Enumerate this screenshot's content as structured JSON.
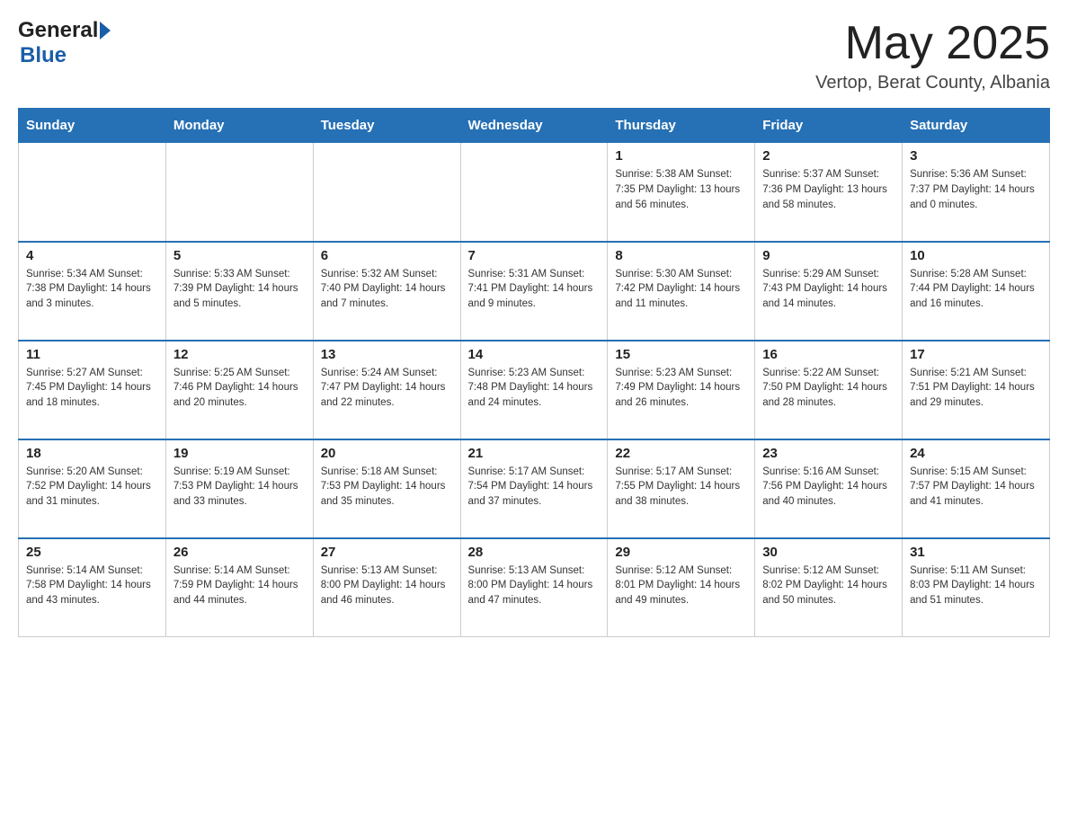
{
  "header": {
    "logo": {
      "general": "General",
      "blue": "Blue"
    },
    "month_year": "May 2025",
    "location": "Vertop, Berat County, Albania"
  },
  "weekdays": [
    "Sunday",
    "Monday",
    "Tuesday",
    "Wednesday",
    "Thursday",
    "Friday",
    "Saturday"
  ],
  "weeks": [
    [
      {
        "day": "",
        "info": ""
      },
      {
        "day": "",
        "info": ""
      },
      {
        "day": "",
        "info": ""
      },
      {
        "day": "",
        "info": ""
      },
      {
        "day": "1",
        "info": "Sunrise: 5:38 AM\nSunset: 7:35 PM\nDaylight: 13 hours\nand 56 minutes."
      },
      {
        "day": "2",
        "info": "Sunrise: 5:37 AM\nSunset: 7:36 PM\nDaylight: 13 hours\nand 58 minutes."
      },
      {
        "day": "3",
        "info": "Sunrise: 5:36 AM\nSunset: 7:37 PM\nDaylight: 14 hours\nand 0 minutes."
      }
    ],
    [
      {
        "day": "4",
        "info": "Sunrise: 5:34 AM\nSunset: 7:38 PM\nDaylight: 14 hours\nand 3 minutes."
      },
      {
        "day": "5",
        "info": "Sunrise: 5:33 AM\nSunset: 7:39 PM\nDaylight: 14 hours\nand 5 minutes."
      },
      {
        "day": "6",
        "info": "Sunrise: 5:32 AM\nSunset: 7:40 PM\nDaylight: 14 hours\nand 7 minutes."
      },
      {
        "day": "7",
        "info": "Sunrise: 5:31 AM\nSunset: 7:41 PM\nDaylight: 14 hours\nand 9 minutes."
      },
      {
        "day": "8",
        "info": "Sunrise: 5:30 AM\nSunset: 7:42 PM\nDaylight: 14 hours\nand 11 minutes."
      },
      {
        "day": "9",
        "info": "Sunrise: 5:29 AM\nSunset: 7:43 PM\nDaylight: 14 hours\nand 14 minutes."
      },
      {
        "day": "10",
        "info": "Sunrise: 5:28 AM\nSunset: 7:44 PM\nDaylight: 14 hours\nand 16 minutes."
      }
    ],
    [
      {
        "day": "11",
        "info": "Sunrise: 5:27 AM\nSunset: 7:45 PM\nDaylight: 14 hours\nand 18 minutes."
      },
      {
        "day": "12",
        "info": "Sunrise: 5:25 AM\nSunset: 7:46 PM\nDaylight: 14 hours\nand 20 minutes."
      },
      {
        "day": "13",
        "info": "Sunrise: 5:24 AM\nSunset: 7:47 PM\nDaylight: 14 hours\nand 22 minutes."
      },
      {
        "day": "14",
        "info": "Sunrise: 5:23 AM\nSunset: 7:48 PM\nDaylight: 14 hours\nand 24 minutes."
      },
      {
        "day": "15",
        "info": "Sunrise: 5:23 AM\nSunset: 7:49 PM\nDaylight: 14 hours\nand 26 minutes."
      },
      {
        "day": "16",
        "info": "Sunrise: 5:22 AM\nSunset: 7:50 PM\nDaylight: 14 hours\nand 28 minutes."
      },
      {
        "day": "17",
        "info": "Sunrise: 5:21 AM\nSunset: 7:51 PM\nDaylight: 14 hours\nand 29 minutes."
      }
    ],
    [
      {
        "day": "18",
        "info": "Sunrise: 5:20 AM\nSunset: 7:52 PM\nDaylight: 14 hours\nand 31 minutes."
      },
      {
        "day": "19",
        "info": "Sunrise: 5:19 AM\nSunset: 7:53 PM\nDaylight: 14 hours\nand 33 minutes."
      },
      {
        "day": "20",
        "info": "Sunrise: 5:18 AM\nSunset: 7:53 PM\nDaylight: 14 hours\nand 35 minutes."
      },
      {
        "day": "21",
        "info": "Sunrise: 5:17 AM\nSunset: 7:54 PM\nDaylight: 14 hours\nand 37 minutes."
      },
      {
        "day": "22",
        "info": "Sunrise: 5:17 AM\nSunset: 7:55 PM\nDaylight: 14 hours\nand 38 minutes."
      },
      {
        "day": "23",
        "info": "Sunrise: 5:16 AM\nSunset: 7:56 PM\nDaylight: 14 hours\nand 40 minutes."
      },
      {
        "day": "24",
        "info": "Sunrise: 5:15 AM\nSunset: 7:57 PM\nDaylight: 14 hours\nand 41 minutes."
      }
    ],
    [
      {
        "day": "25",
        "info": "Sunrise: 5:14 AM\nSunset: 7:58 PM\nDaylight: 14 hours\nand 43 minutes."
      },
      {
        "day": "26",
        "info": "Sunrise: 5:14 AM\nSunset: 7:59 PM\nDaylight: 14 hours\nand 44 minutes."
      },
      {
        "day": "27",
        "info": "Sunrise: 5:13 AM\nSunset: 8:00 PM\nDaylight: 14 hours\nand 46 minutes."
      },
      {
        "day": "28",
        "info": "Sunrise: 5:13 AM\nSunset: 8:00 PM\nDaylight: 14 hours\nand 47 minutes."
      },
      {
        "day": "29",
        "info": "Sunrise: 5:12 AM\nSunset: 8:01 PM\nDaylight: 14 hours\nand 49 minutes."
      },
      {
        "day": "30",
        "info": "Sunrise: 5:12 AM\nSunset: 8:02 PM\nDaylight: 14 hours\nand 50 minutes."
      },
      {
        "day": "31",
        "info": "Sunrise: 5:11 AM\nSunset: 8:03 PM\nDaylight: 14 hours\nand 51 minutes."
      }
    ]
  ]
}
